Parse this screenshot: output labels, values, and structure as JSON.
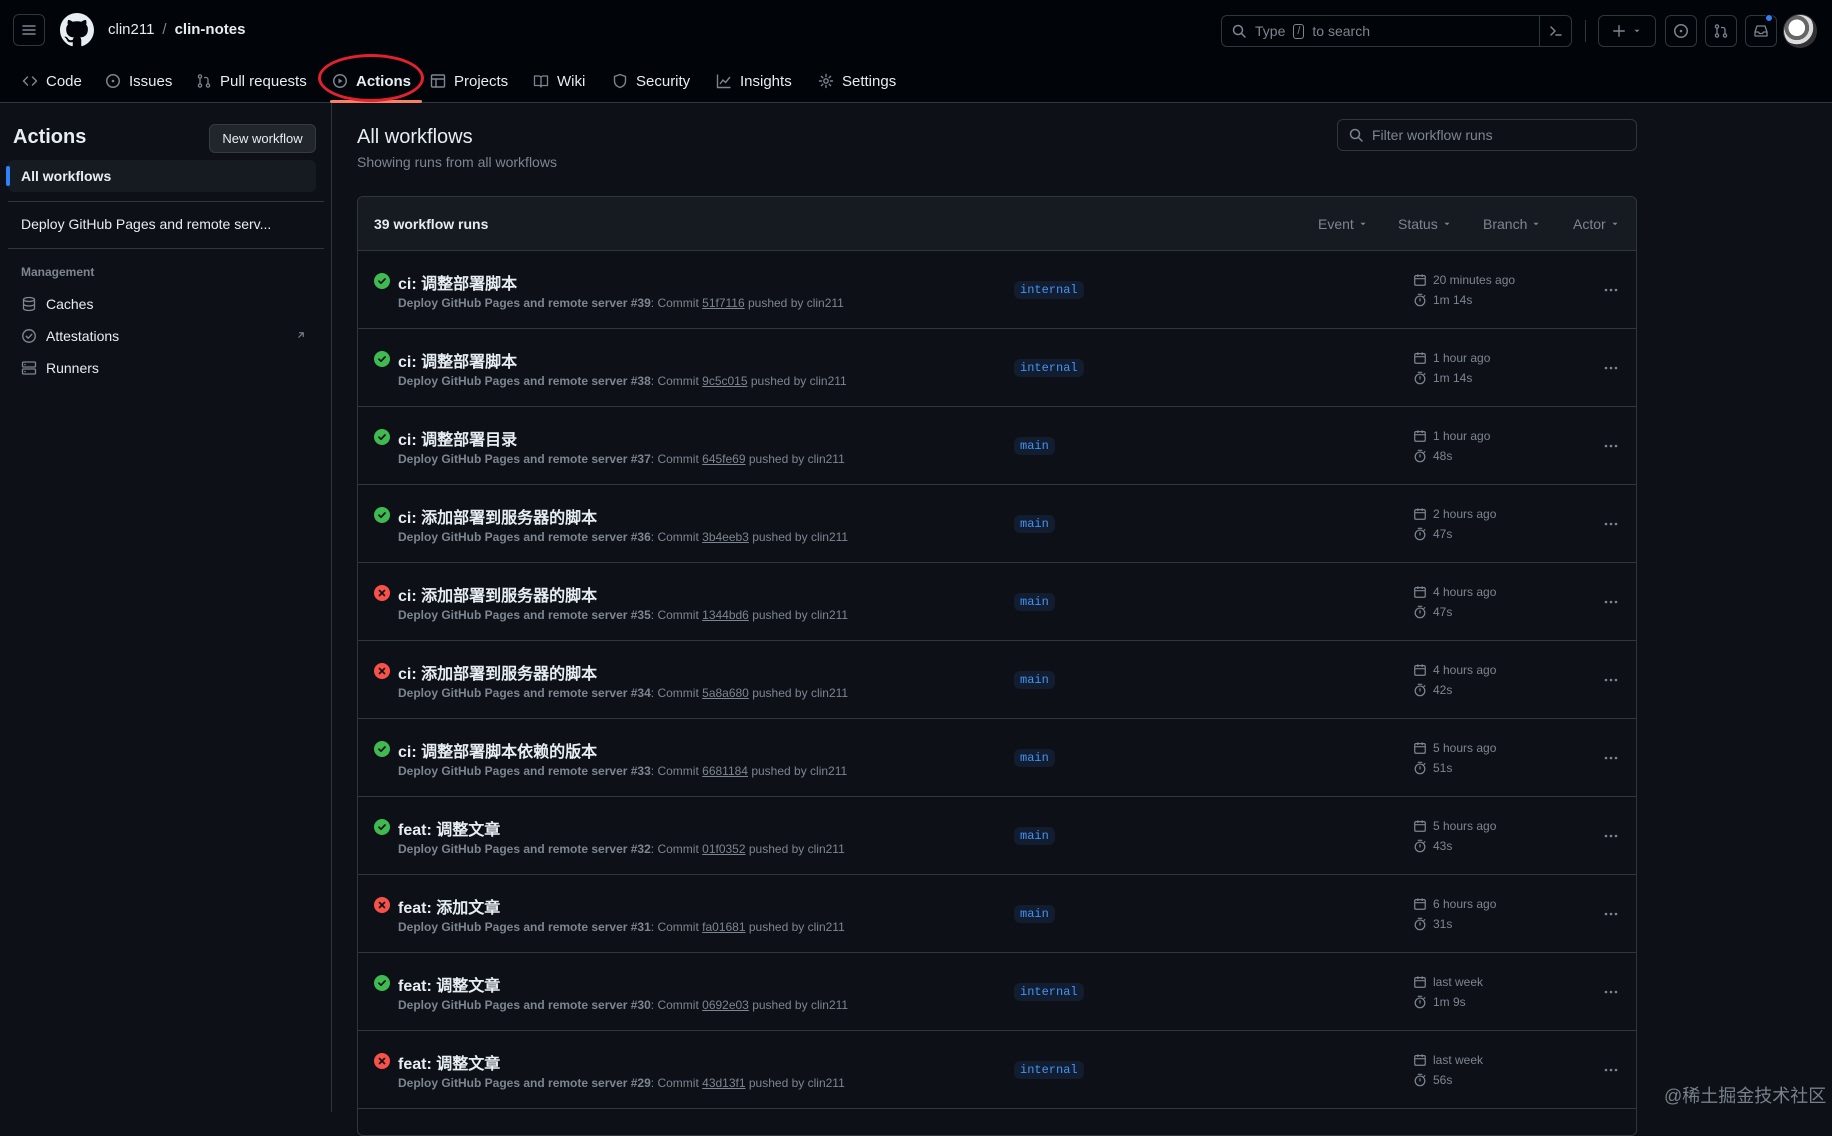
{
  "repo": {
    "owner": "clin211",
    "separator": "/",
    "name": "clin-notes"
  },
  "search": {
    "prefix": "Type",
    "key": "/",
    "suffix": "to search"
  },
  "tabs": [
    {
      "label": "Code",
      "icon": "code-icon"
    },
    {
      "label": "Issues",
      "icon": "issue-opened-icon"
    },
    {
      "label": "Pull requests",
      "icon": "git-pull-request-icon"
    },
    {
      "label": "Actions",
      "icon": "play-icon"
    },
    {
      "label": "Projects",
      "icon": "table-icon"
    },
    {
      "label": "Wiki",
      "icon": "book-icon"
    },
    {
      "label": "Security",
      "icon": "shield-icon"
    },
    {
      "label": "Insights",
      "icon": "graph-icon"
    },
    {
      "label": "Settings",
      "icon": "gear-icon"
    }
  ],
  "sidebar": {
    "title": "Actions",
    "new_workflow": "New workflow",
    "all_workflows": "All workflows",
    "workflow": "Deploy GitHub Pages and remote serv...",
    "management_heading": "Management",
    "management": [
      {
        "label": "Caches",
        "icon": "database-icon"
      },
      {
        "label": "Attestations",
        "icon": "verified-icon"
      },
      {
        "label": "Runners",
        "icon": "server-icon"
      }
    ]
  },
  "main": {
    "title": "All workflows",
    "subtitle": "Showing runs from all workflows",
    "filter_placeholder": "Filter workflow runs",
    "runs_count": "39 workflow runs",
    "filters": [
      "Event",
      "Status",
      "Branch",
      "Actor"
    ]
  },
  "runs": [
    {
      "status": "success",
      "title": "ci: 调整部署脚本",
      "workflow": "Deploy GitHub Pages and remote server",
      "number": "#39",
      "sha": "51f7116",
      "actor": "clin211",
      "branch": "internal",
      "when": "20 minutes ago",
      "duration": "1m 14s"
    },
    {
      "status": "success",
      "title": "ci: 调整部署脚本",
      "workflow": "Deploy GitHub Pages and remote server",
      "number": "#38",
      "sha": "9c5c015",
      "actor": "clin211",
      "branch": "internal",
      "when": "1 hour ago",
      "duration": "1m 14s"
    },
    {
      "status": "success",
      "title": "ci: 调整部署目录",
      "workflow": "Deploy GitHub Pages and remote server",
      "number": "#37",
      "sha": "645fe69",
      "actor": "clin211",
      "branch": "main",
      "when": "1 hour ago",
      "duration": "48s"
    },
    {
      "status": "success",
      "title": "ci: 添加部署到服务器的脚本",
      "workflow": "Deploy GitHub Pages and remote server",
      "number": "#36",
      "sha": "3b4eeb3",
      "actor": "clin211",
      "branch": "main",
      "when": "2 hours ago",
      "duration": "47s"
    },
    {
      "status": "failure",
      "title": "ci: 添加部署到服务器的脚本",
      "workflow": "Deploy GitHub Pages and remote server",
      "number": "#35",
      "sha": "1344bd6",
      "actor": "clin211",
      "branch": "main",
      "when": "4 hours ago",
      "duration": "47s"
    },
    {
      "status": "failure",
      "title": "ci: 添加部署到服务器的脚本",
      "workflow": "Deploy GitHub Pages and remote server",
      "number": "#34",
      "sha": "5a8a680",
      "actor": "clin211",
      "branch": "main",
      "when": "4 hours ago",
      "duration": "42s"
    },
    {
      "status": "success",
      "title": "ci: 调整部署脚本依赖的版本",
      "workflow": "Deploy GitHub Pages and remote server",
      "number": "#33",
      "sha": "6681184",
      "actor": "clin211",
      "branch": "main",
      "when": "5 hours ago",
      "duration": "51s"
    },
    {
      "status": "success",
      "title": "feat: 调整文章",
      "workflow": "Deploy GitHub Pages and remote server",
      "number": "#32",
      "sha": "01f0352",
      "actor": "clin211",
      "branch": "main",
      "when": "5 hours ago",
      "duration": "43s"
    },
    {
      "status": "failure",
      "title": "feat: 添加文章",
      "workflow": "Deploy GitHub Pages and remote server",
      "number": "#31",
      "sha": "fa01681",
      "actor": "clin211",
      "branch": "main",
      "when": "6 hours ago",
      "duration": "31s"
    },
    {
      "status": "success",
      "title": "feat: 调整文章",
      "workflow": "Deploy GitHub Pages and remote server",
      "number": "#30",
      "sha": "0692e03",
      "actor": "clin211",
      "branch": "internal",
      "when": "last week",
      "duration": "1m 9s"
    },
    {
      "status": "failure",
      "title": "feat: 调整文章",
      "workflow": "Deploy GitHub Pages and remote server",
      "number": "#29",
      "sha": "43d13f1",
      "actor": "clin211",
      "branch": "internal",
      "when": "last week",
      "duration": "56s"
    }
  ],
  "run_labels": {
    "commit": "Commit",
    "pushed_by": "pushed by"
  },
  "watermark": "@稀土掘金技术社区",
  "colors": {
    "success": "#3fb950",
    "failure": "#f85149",
    "accent": "#2f81f7",
    "active_tab_underline": "#f78166",
    "highlight_ring": "#e3212f"
  }
}
